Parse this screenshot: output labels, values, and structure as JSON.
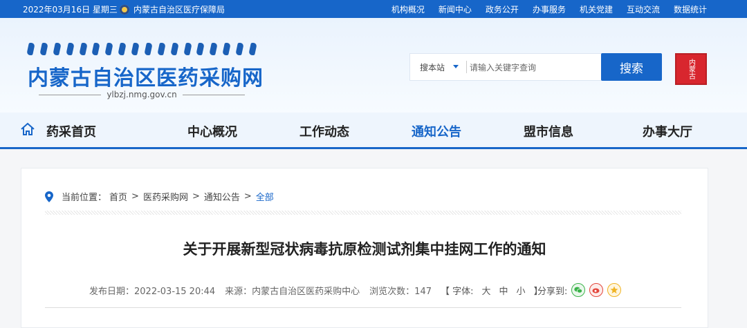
{
  "topbar": {
    "date": "2022年03月16日 星期三",
    "bureau": "内蒙古自治区医疗保障局",
    "links": [
      "机构概况",
      "新闻中心",
      "政务公开",
      "办事服务",
      "机关党建",
      "互动交流",
      "数据统计"
    ]
  },
  "header": {
    "site_title": "内蒙古自治区医药采购网",
    "site_url": "ylbzj.nmg.gov.cn",
    "search_scope": "搜本站",
    "search_placeholder": "请输入关键字查询",
    "search_button": "搜索",
    "seal_text": "内蒙古"
  },
  "nav": {
    "items": [
      "药采首页",
      "中心概况",
      "工作动态",
      "通知公告",
      "盟市信息",
      "办事大厅"
    ],
    "active": "通知公告"
  },
  "breadcrumb": {
    "label": "当前位置：",
    "items": [
      "首页",
      "医药采购网",
      "通知公告",
      "全部"
    ]
  },
  "article": {
    "title": "关于开展新型冠状病毒抗原检测试剂集中挂网工作的通知",
    "publish_date": "发布日期：2022-03-15 20:44",
    "source": "来源：内蒙古自治区医药采购中心",
    "views": "浏览次数：147",
    "font_label": "【 字体:",
    "font_options": [
      "大",
      "中",
      "小"
    ],
    "font_close": "】",
    "share_label": "分享到:"
  },
  "icons": [
    "location-pin-icon",
    "home-icon",
    "wechat-icon",
    "weibo-icon",
    "qzone-icon",
    "dropdown-caret-icon"
  ],
  "colors": {
    "primary": "#1766c9",
    "seal": "#d8262e"
  }
}
